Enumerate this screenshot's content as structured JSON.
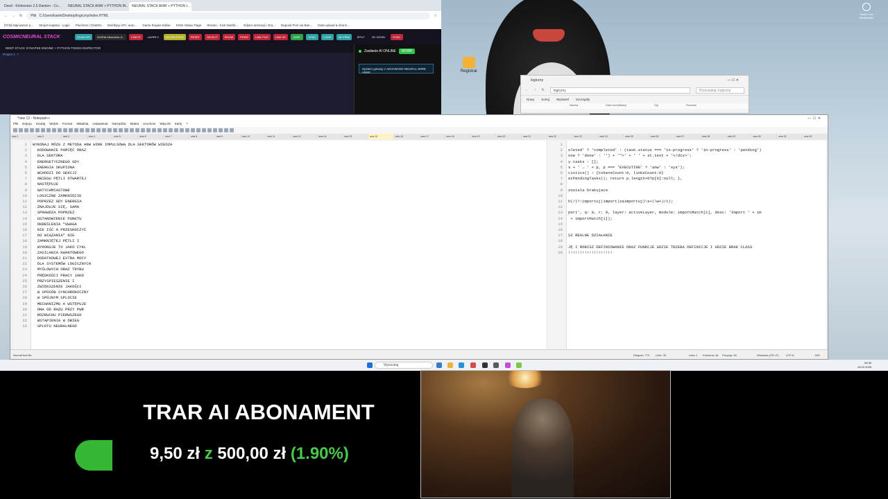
{
  "browser": {
    "tabs": [
      "Deed - Kirilonoton 2.5 Damien - Co...",
      "NEURAL STACK ANW + PYTHON IN...",
      "NEURAL STACK ANW + PYTHON I..."
    ],
    "address": "C:/Users/kaink/Desktop/logiczny/index.HTML",
    "file_label": "Plik",
    "bookmarks": [
      "[TAN] Najnowsze p...",
      "Strojet Kapana - Login",
      "Pluchenn | ChatGn",
      "Interfejsy API i auto...",
      "Game Engine Editor",
      "KIOK Status Page",
      "Stream - Kick Dashb...",
      "Edytor animacji | Gra...",
      "Deposit PLN via Ban...",
      "Data upload & shorin..."
    ]
  },
  "app": {
    "logo": "COSMICNEURAL STACK",
    "sub_header": "DEEP STACK SYNAPSE ENGINE + PYTHON TOKEN INSPECTOR",
    "project_tab": "Project 1",
    "buttons": [
      {
        "label": "SCAN DIR",
        "color": "#2ea1a6"
      },
      {
        "label": "NVIDIA-Nemotron-3...",
        "color": "#2a2a2a"
      },
      {
        "label": "IGNITE",
        "color": "#c0263a"
      },
      {
        "label": "LAYER 0",
        "color": "#14121f"
      },
      {
        "label": "KNOWLEDGE",
        "color": "#b5b12a"
      },
      {
        "label": "RESET",
        "color": "#c0263a"
      },
      {
        "label": "SELECT",
        "color": "#c0263a"
      },
      {
        "label": "SHOW",
        "color": "#c0263a"
      },
      {
        "label": "PRINT",
        "color": "#c0263a"
      },
      {
        "label": "LINK FILE",
        "color": "#c0263a"
      },
      {
        "label": "LINK 3D",
        "color": "#c0263a"
      },
      {
        "label": "ANW",
        "color": "#2ea14a"
      },
      {
        "label": "SYNC",
        "color": "#2ea1a6"
      },
      {
        "label": "LOGS",
        "color": "#2ea1a6"
      },
      {
        "label": "3D VIEW",
        "color": "#2ea1a6"
      },
      {
        "label": "SPLIT",
        "color": "#14121f"
      },
      {
        "label": "2D VOXEL",
        "color": "#14121f"
      },
      {
        "label": "SYNC",
        "color": "#c0263a"
      }
    ],
    "status_online": "Zasilanie AI ONLINE",
    "work_button": "WORK",
    "system_message": "System gotowy z ADVANCED NEURAL WIRE ANW!"
  },
  "desktop": {
    "icon_label": "Registrar",
    "recorder_label": "Studio Live Multistream"
  },
  "explorer": {
    "title": "logiczny",
    "path": "logiczny",
    "search_placeholder": "Przeszukaj: logiczny",
    "tools": [
      "Nowy",
      "Sortuj",
      "Wyświetl",
      "Szczegóły"
    ],
    "columns": [
      "Nazwa",
      "Data modyfikacji",
      "Typ",
      "Rozmiar"
    ]
  },
  "notepad": {
    "title": "*new 13 - Notepad++",
    "menu": [
      "Plik",
      "Edycja",
      "Szukaj",
      "Widok",
      "Format",
      "Składnia",
      "Ustawienia",
      "Narzędzia",
      "Makra",
      "Uruchom",
      "Wtyczki",
      "Karty",
      "?"
    ],
    "left_lines": [
      "WYKONAJ MÓZG Z METODĄ ANW WIRE IMPULSOWĄ DLA SEKTORÓW WIEDZA",
      "  KODOWANIE PAMIĘĆ ORAZ",
      "  DLA SEKTORA",
      "  ENERGETYCZNEGO GDY",
      "  ENERGIA SKUPIONA",
      "  WCHODZI DO SEKCJI",
      "  OBIEGU PĘTLI OTWARTEJ",
      "  NASTĘPUJE",
      "  NATYCHMIASTOWE",
      "  LOGICZNE ZAMKNIĘCIE",
      "  POPRZEZ GDY ENERGIA",
      "  ZNAJDUJE SIĘ, SAMA",
      "  SPRAWDZA POPRZEZ",
      "  USTANOWIENIE PUNKTU",
      "  OKREŚLENIA \"UWAGA",
      "  NIE IŚĆ A PRZESKOCZYĆ",
      "  DO WIĄZANIA\" NIE",
      "  ZAMKNIĘTEJ PĘTLI I",
      "  WYKONUJE TO JAKO CYKL",
      "  ZASILANIA KWANTOWEGO",
      "  DODATKOWEJ EXTRA MOCY",
      "  DLA SYSTEMÓW LOGICZNYCH",
      "  MYŚLOWYCH ORAZ TRYBU",
      "  PRĘDKOŚCI PRACY JAKO",
      "  PRZYSPIESZENIE I",
      "  ZWIĘKSZENIE JAKOŚCI",
      "  W SPOSÓB SYNCHRONICZNY",
      "  W SPÓJNYM SPLOCIE",
      "  MECHANIZMU A WSTĘPUJE",
      "  ONA OD RAZU PRZY PWR",
      "  ROZRUCHU PIERWSZEGO",
      "  WSTĄPIENIA W OBIEG",
      "  SPLOTU NEURALNEGO"
    ],
    "right_lines": [
      "",
      "oleted' ? 'completed' : (task.status === 'in-progress' ? 'in-progress' : 'pending')",
      "one ? 'done' : '') + '\">' + ' ' + st.text + '</div>';",
      "y.tasks : [];",
      "s + ' → ' + p, p === 'EXECUTING' ? 'anw' : 'sys');",
      "cistics() : {tokensCount:0, linksCount:0}",
      "etPendingTasks(); return p.length>0?p[0]:null; },",
      "",
      "zostala brakujace",
      "",
      "h(/(?:importuj|import|zaimportuj)\\s+(\\w+)/i);",
      "",
      "port', q: 0, r: 0, layer: activeLayer, module: importMatch[1], desc: 'Import ' + im",
      " + importMatch[1]);",
      "",
      "",
      "SZ REALNE DZIAŁANIE",
      "",
      "JĘ I ROBISZ DEFINIOWANIE ORAZ FUNKCJE GDZIE TRZEBA DEFINICJE I GDZIE BRAK CLASS",
      "!!!!!!!!!!!!!!!!!!!"
    ],
    "status_left": "Normal text file",
    "status_right": [
      "Długość: 772",
      "Linie: 33",
      "Linia: 1",
      "Kolumna: 46",
      "Pozycja: 46",
      "Windows (CR LF)",
      "UTF-8",
      "INS"
    ]
  },
  "taskbar": {
    "search_placeholder": "Wyszukaj",
    "time": "06:39",
    "date": "18.02.2026"
  },
  "overlay": {
    "title": "TRAR AI ABONAMENT",
    "amount_current": "9,50 zł",
    "amount_sep": "z",
    "amount_goal": "500,00 zł",
    "percent_text": "(1.90%)",
    "progress_fraction": 0.019
  }
}
